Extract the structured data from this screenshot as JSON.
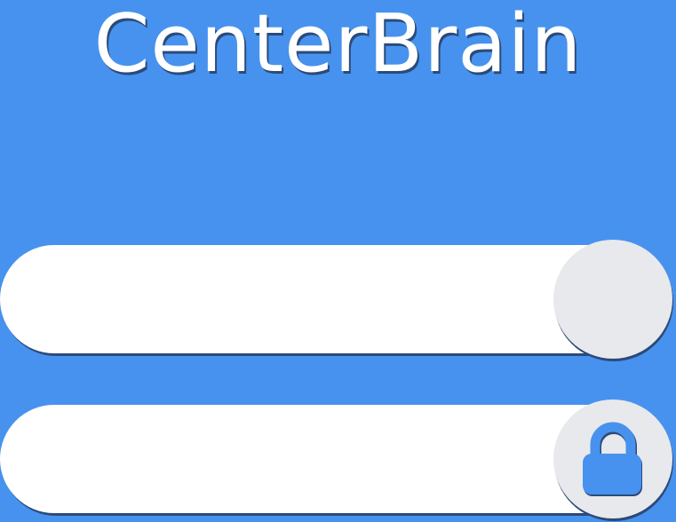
{
  "app": {
    "title": "CenterBrain"
  },
  "login": {
    "username_field": {
      "value": "",
      "placeholder": ""
    },
    "password_field": {
      "value": "",
      "placeholder": "",
      "icon": "lock-icon"
    }
  },
  "colors": {
    "background": "#4792ee",
    "field": "#ffffff",
    "knob": "#e8e9ec",
    "accent": "#4792ee",
    "shadow": "#2b4a7a"
  }
}
